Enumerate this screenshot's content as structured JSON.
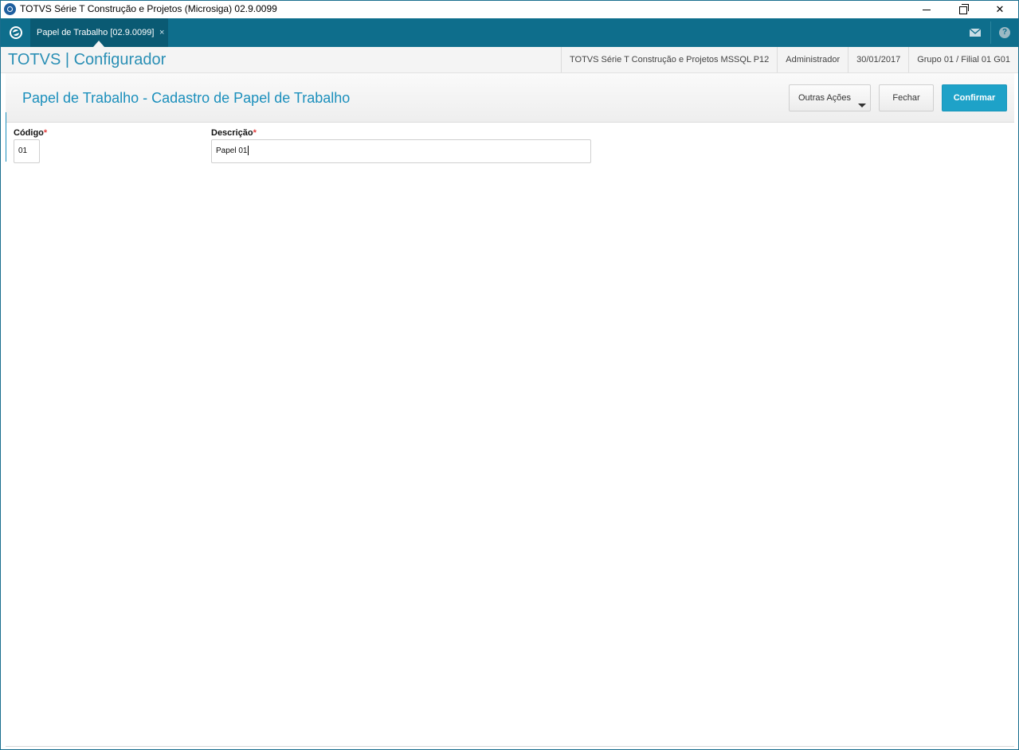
{
  "window": {
    "title": "TOTVS Série T Construção e Projetos (Microsiga) 02.9.0099"
  },
  "tabbar": {
    "tab_label": "Papel de Trabalho [02.9.0099]",
    "tab_close": "×",
    "help_glyph": "?"
  },
  "header": {
    "brand": "TOTVS | Configurador",
    "environment": "TOTVS Série T Construção e Projetos MSSQL P12",
    "user": "Administrador",
    "date": "30/01/2017",
    "company": "Grupo 01 / Filial 01 G01"
  },
  "actionbar": {
    "page_title": "Papel de Trabalho - Cadastro de Papel de Trabalho",
    "outras_acoes_label": "Outras Ações",
    "fechar_label": "Fechar",
    "confirmar_label": "Confirmar"
  },
  "form": {
    "codigo": {
      "label": "Código",
      "required_mark": "*",
      "value": "01"
    },
    "descricao": {
      "label": "Descrição",
      "required_mark": "*",
      "value": "Papel 01"
    }
  },
  "colors": {
    "tabbar": "#0e6e8c",
    "accent": "#1ea2c8",
    "brand_text": "#2a8fb5",
    "required": "#e23d3d"
  },
  "icons": [
    "app-icon",
    "minimize-icon",
    "maximize-icon",
    "close-icon",
    "totvs-home-icon",
    "mail-icon",
    "help-icon",
    "dropdown-caret-icon"
  ]
}
